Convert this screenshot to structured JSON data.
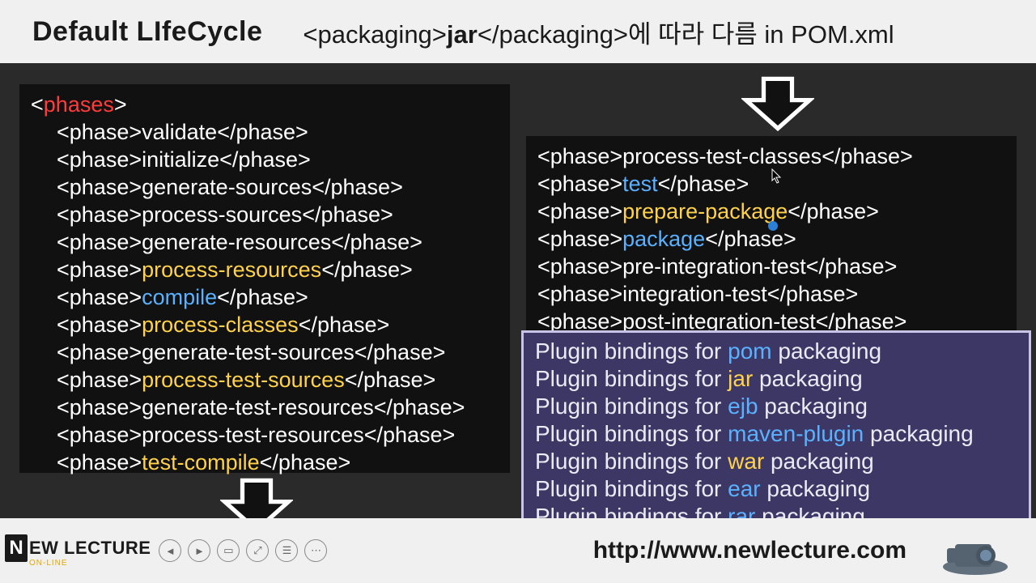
{
  "header": {
    "title": "Default LIfeCycle",
    "sub_pre": "<packaging>",
    "sub_bold": "jar",
    "sub_post": "</packaging>에 따라 다름 in POM.xml"
  },
  "left": {
    "root_open": "phases",
    "items": [
      {
        "txt": "validate",
        "cls": ""
      },
      {
        "txt": "initialize",
        "cls": ""
      },
      {
        "txt": "generate-sources",
        "cls": ""
      },
      {
        "txt": "process-sources",
        "cls": ""
      },
      {
        "txt": "generate-resources",
        "cls": ""
      },
      {
        "txt": "process-resources",
        "cls": "tag-yellow"
      },
      {
        "txt": "compile",
        "cls": "tag-blue"
      },
      {
        "txt": "process-classes",
        "cls": "tag-yellow"
      },
      {
        "txt": "generate-test-sources",
        "cls": ""
      },
      {
        "txt": "process-test-sources",
        "cls": "tag-yellow"
      },
      {
        "txt": "generate-test-resources",
        "cls": ""
      },
      {
        "txt": "process-test-resources",
        "cls": ""
      },
      {
        "txt": "test-compile",
        "cls": "tag-yellow"
      }
    ]
  },
  "right": {
    "items": [
      {
        "txt": "process-test-classes",
        "cls": ""
      },
      {
        "txt": "test",
        "cls": "tag-blue"
      },
      {
        "txt": "prepare-package",
        "cls": "tag-yellow"
      },
      {
        "txt": "package",
        "cls": "tag-blue"
      },
      {
        "txt": "pre-integration-test",
        "cls": ""
      },
      {
        "txt": "integration-test",
        "cls": ""
      },
      {
        "txt": "post-integration-test",
        "cls": ""
      }
    ]
  },
  "overlay": {
    "prefix": "Plugin bindings for ",
    "suffix": " packaging",
    "items": [
      {
        "word": "pom",
        "cls": "ov-word"
      },
      {
        "word": "jar",
        "cls": "ov-jar"
      },
      {
        "word": "ejb",
        "cls": "ov-word"
      },
      {
        "word": "maven-plugin",
        "cls": "ov-word"
      },
      {
        "word": "war",
        "cls": "ov-war"
      },
      {
        "word": "ear",
        "cls": "ov-word"
      },
      {
        "word": "rar",
        "cls": "ov-word"
      }
    ]
  },
  "footer": {
    "logo_text": "EW LECTURE",
    "logo_sub": "ON-LINE",
    "url": "http://www.newlecture.com"
  }
}
